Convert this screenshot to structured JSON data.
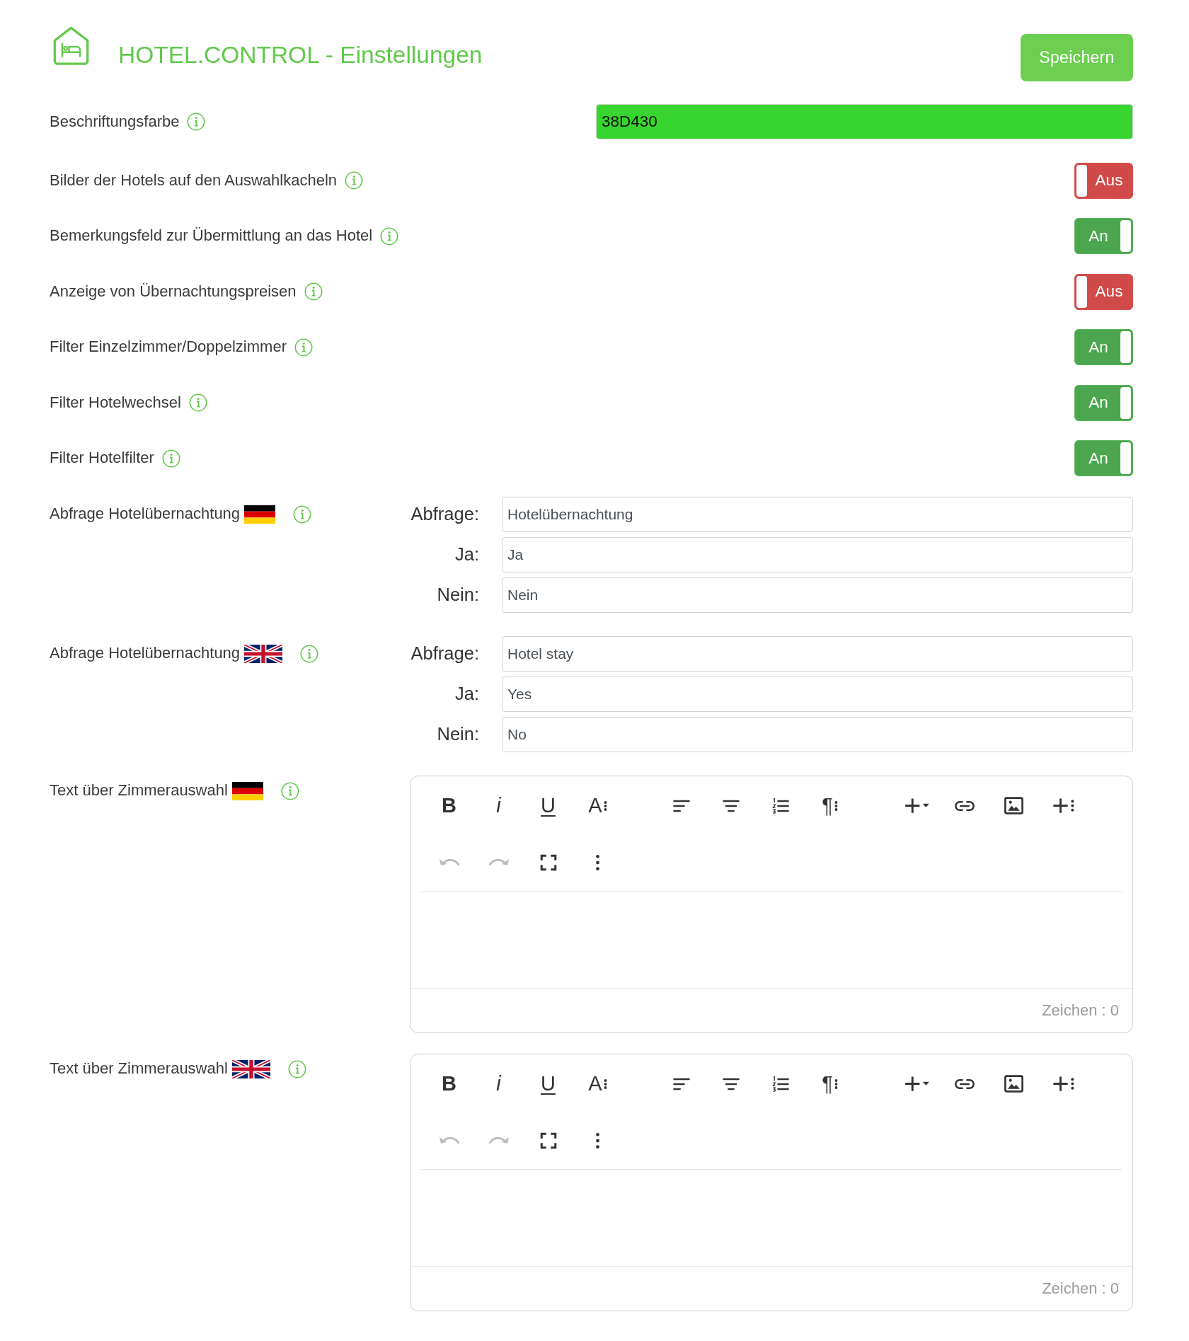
{
  "header": {
    "title": "HOTEL.CONTROL - Einstellungen",
    "save_button": "Speichern"
  },
  "color_setting": {
    "label": "Beschriftungsfarbe",
    "value": "38D430"
  },
  "toggles": [
    {
      "label": "Bilder der Hotels auf den Auswahlkacheln",
      "on": false,
      "state_text": "Aus"
    },
    {
      "label": "Bemerkungsfeld zur Übermittlung an das Hotel",
      "on": true,
      "state_text": "An"
    },
    {
      "label": "Anzeige von Übernachtungspreisen",
      "on": false,
      "state_text": "Aus"
    },
    {
      "label": "Filter Einzelzimmer/Doppelzimmer",
      "on": true,
      "state_text": "An"
    },
    {
      "label": "Filter Hotelwechsel",
      "on": true,
      "state_text": "An"
    },
    {
      "label": "Filter Hotelfilter",
      "on": true,
      "state_text": "An"
    }
  ],
  "queries": [
    {
      "label": "Abfrage Hotelübernachtung",
      "kind": "german",
      "fields": [
        {
          "label": "Abfrage:",
          "value": "Hotelübernachtung"
        },
        {
          "label": "Ja:",
          "value": "Ja"
        },
        {
          "label": "Nein:",
          "value": "Nein"
        }
      ]
    },
    {
      "label": "Abfrage Hotelübernachtung",
      "kind": "english",
      "fields": [
        {
          "label": "Abfrage:",
          "value": "Hotel stay"
        },
        {
          "label": "Ja:",
          "value": "Yes"
        },
        {
          "label": "Nein:",
          "value": "No"
        }
      ]
    }
  ],
  "editors": [
    {
      "label": "Text über Zimmerauswahl",
      "kind": "german",
      "toolbar": [
        [
          [
            {
              "kind": "bold",
              "text": "B",
              "disabled": false
            },
            {
              "kind": "italic",
              "text": "i",
              "disabled": false
            },
            {
              "kind": "underline",
              "text": "U",
              "disabled": false
            },
            {
              "kind": "font-size",
              "text": "A",
              "disabled": false
            }
          ],
          [
            {
              "kind": "align-left",
              "disabled": false
            },
            {
              "kind": "align-center",
              "disabled": false
            },
            {
              "kind": "ordered-list",
              "disabled": false
            },
            {
              "kind": "paragraph-format",
              "text": "¶",
              "disabled": false
            }
          ],
          [
            {
              "kind": "insert",
              "disabled": false
            },
            {
              "kind": "link",
              "disabled": false
            },
            {
              "kind": "image",
              "disabled": false
            },
            {
              "kind": "more-insert",
              "disabled": false
            }
          ]
        ],
        [
          [
            {
              "kind": "undo",
              "disabled": true
            },
            {
              "kind": "redo",
              "disabled": true
            },
            {
              "kind": "fullscreen",
              "disabled": false
            },
            {
              "kind": "more",
              "disabled": false
            }
          ]
        ]
      ],
      "char_count": "Zeichen : 0"
    },
    {
      "label": "Text über Zimmerauswahl",
      "kind": "english",
      "toolbar": [
        [
          [
            {
              "kind": "bold",
              "text": "B",
              "disabled": false
            },
            {
              "kind": "italic",
              "text": "i",
              "disabled": false
            },
            {
              "kind": "underline",
              "text": "U",
              "disabled": false
            },
            {
              "kind": "font-size",
              "text": "A",
              "disabled": false
            }
          ],
          [
            {
              "kind": "align-left",
              "disabled": false
            },
            {
              "kind": "align-center",
              "disabled": false
            },
            {
              "kind": "ordered-list",
              "disabled": false
            },
            {
              "kind": "paragraph-format",
              "text": "¶",
              "disabled": false
            }
          ],
          [
            {
              "kind": "insert",
              "disabled": false
            },
            {
              "kind": "link",
              "disabled": false
            },
            {
              "kind": "image",
              "disabled": false
            },
            {
              "kind": "more-insert",
              "disabled": false
            }
          ]
        ],
        [
          [
            {
              "kind": "undo",
              "disabled": true
            },
            {
              "kind": "redo",
              "disabled": true
            },
            {
              "kind": "fullscreen",
              "disabled": false
            },
            {
              "kind": "more",
              "disabled": false
            }
          ]
        ]
      ],
      "char_count": "Zeichen : 0"
    }
  ]
}
